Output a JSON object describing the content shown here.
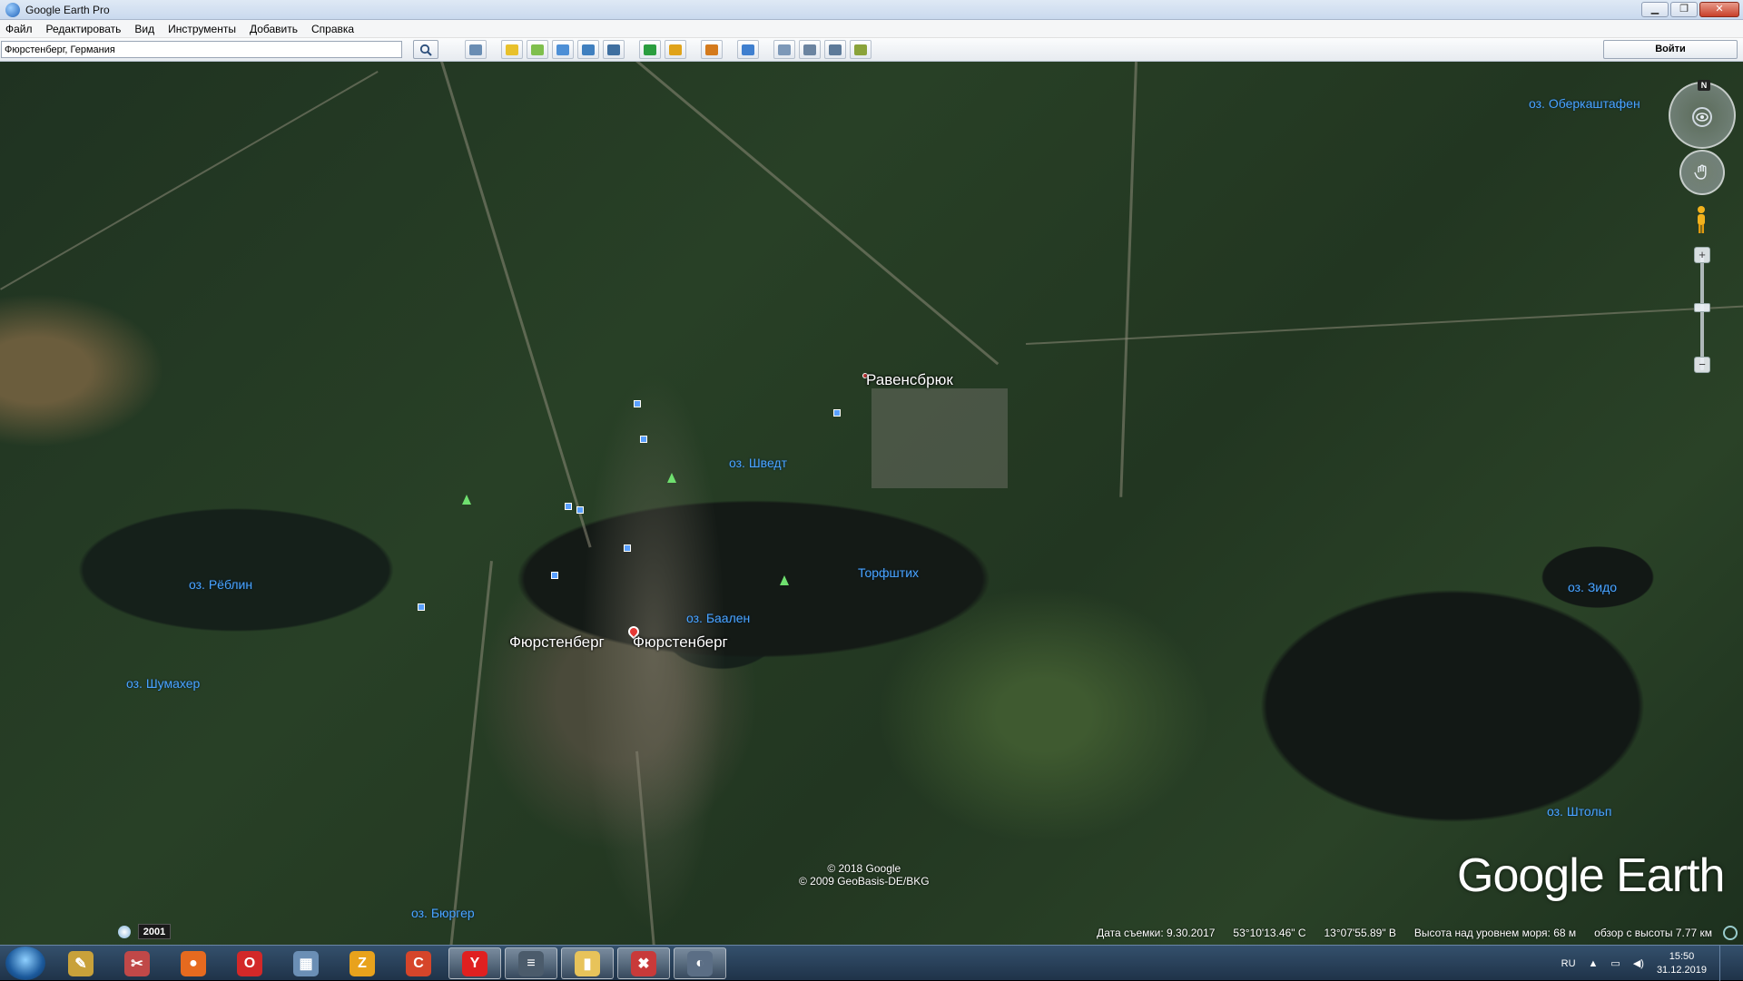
{
  "window": {
    "title": "Google Earth Pro"
  },
  "menu": [
    "Файл",
    "Редактировать",
    "Вид",
    "Инструменты",
    "Добавить",
    "Справка"
  ],
  "search": {
    "value": "Фюрстенберг, Германия"
  },
  "toolbar": {
    "login_label": "Войти",
    "tools": [
      {
        "name": "sidebar-toggle-button",
        "color": "#6a8db3"
      },
      {
        "name": "add-placemark-button",
        "color": "#e8c12c"
      },
      {
        "name": "add-polygon-button",
        "color": "#7fbf4d"
      },
      {
        "name": "add-path-button",
        "color": "#4d8fd6"
      },
      {
        "name": "add-image-overlay-button",
        "color": "#3f7fbf"
      },
      {
        "name": "record-tour-button",
        "color": "#3f6fa0"
      },
      {
        "name": "historical-imagery-button",
        "color": "#2a9d3f"
      },
      {
        "name": "sunlight-button",
        "color": "#e0a31a"
      },
      {
        "name": "switch-planet-button",
        "color": "#d47a1c"
      },
      {
        "name": "ruler-button",
        "color": "#3f7fcf"
      },
      {
        "name": "email-button",
        "color": "#7c98b8"
      },
      {
        "name": "print-button",
        "color": "#6b84a0"
      },
      {
        "name": "save-image-button",
        "color": "#5d7a99"
      },
      {
        "name": "view-in-maps-button",
        "color": "#8aa33a"
      }
    ]
  },
  "map": {
    "lakes": [
      {
        "id": "oberkashtafen",
        "label": "оз. Оберкаштафен"
      },
      {
        "id": "schwedt",
        "label": "оз. Шведт"
      },
      {
        "id": "reblin",
        "label": "оз. Рёблин"
      },
      {
        "id": "torfshtikh",
        "label": "Торфштих"
      },
      {
        "id": "zido",
        "label": "оз. Зидо"
      },
      {
        "id": "baalen",
        "label": "оз. Баален"
      },
      {
        "id": "shumakher",
        "label": "оз. Шумахер"
      },
      {
        "id": "shtolp",
        "label": "оз. Штольп"
      },
      {
        "id": "byurger",
        "label": "оз. Бюргер"
      }
    ],
    "towns": [
      {
        "id": "ravensbruck",
        "label": "Равенсбрюк"
      },
      {
        "id": "furstenberg-1",
        "label": "Фюрстенберг"
      },
      {
        "id": "furstenberg-2",
        "label": "Фюрстенберг"
      }
    ],
    "copyright": [
      "© 2018 Google",
      "© 2009 GeoBasis-DE/BKG"
    ],
    "logo": "Google Earth",
    "historical_year": "2001",
    "north_label": "N"
  },
  "status": {
    "capture_date": "Дата съемки: 9.30.2017",
    "lat": "53°10'13.46\" С",
    "lon": "13°07'55.89\" В",
    "elevation": "Высота над уровнем моря:   68 м",
    "eye_alt": "обзор с высоты   7.77 км"
  },
  "taskbar": {
    "apps": [
      {
        "name": "paint-app",
        "color": "#c8a13a",
        "glyph": "✎"
      },
      {
        "name": "snipping-app",
        "color": "#c04848",
        "glyph": "✂"
      },
      {
        "name": "firefox-app",
        "color": "#e66a1f",
        "glyph": "●"
      },
      {
        "name": "opera-app",
        "color": "#d32828",
        "glyph": "O"
      },
      {
        "name": "calculator-app",
        "color": "#6b8fb5",
        "glyph": "▦"
      },
      {
        "name": "zoom-app",
        "color": "#e8a21c",
        "glyph": "Z"
      },
      {
        "name": "ccleaner-app",
        "color": "#d6452a",
        "glyph": "C"
      },
      {
        "name": "yandex-app",
        "color": "#e02020",
        "glyph": "Y"
      },
      {
        "name": "stack-app",
        "color": "#4b5b6b",
        "glyph": "≡"
      },
      {
        "name": "explorer-app",
        "color": "#e8c35a",
        "glyph": "▮"
      },
      {
        "name": "pdf-app",
        "color": "#c83a3a",
        "glyph": "✖"
      },
      {
        "name": "google-earth-app",
        "color": "#5b6e85",
        "glyph": "◐"
      }
    ],
    "lang": "RU",
    "time": "15:50",
    "date": "31.12.2019"
  }
}
